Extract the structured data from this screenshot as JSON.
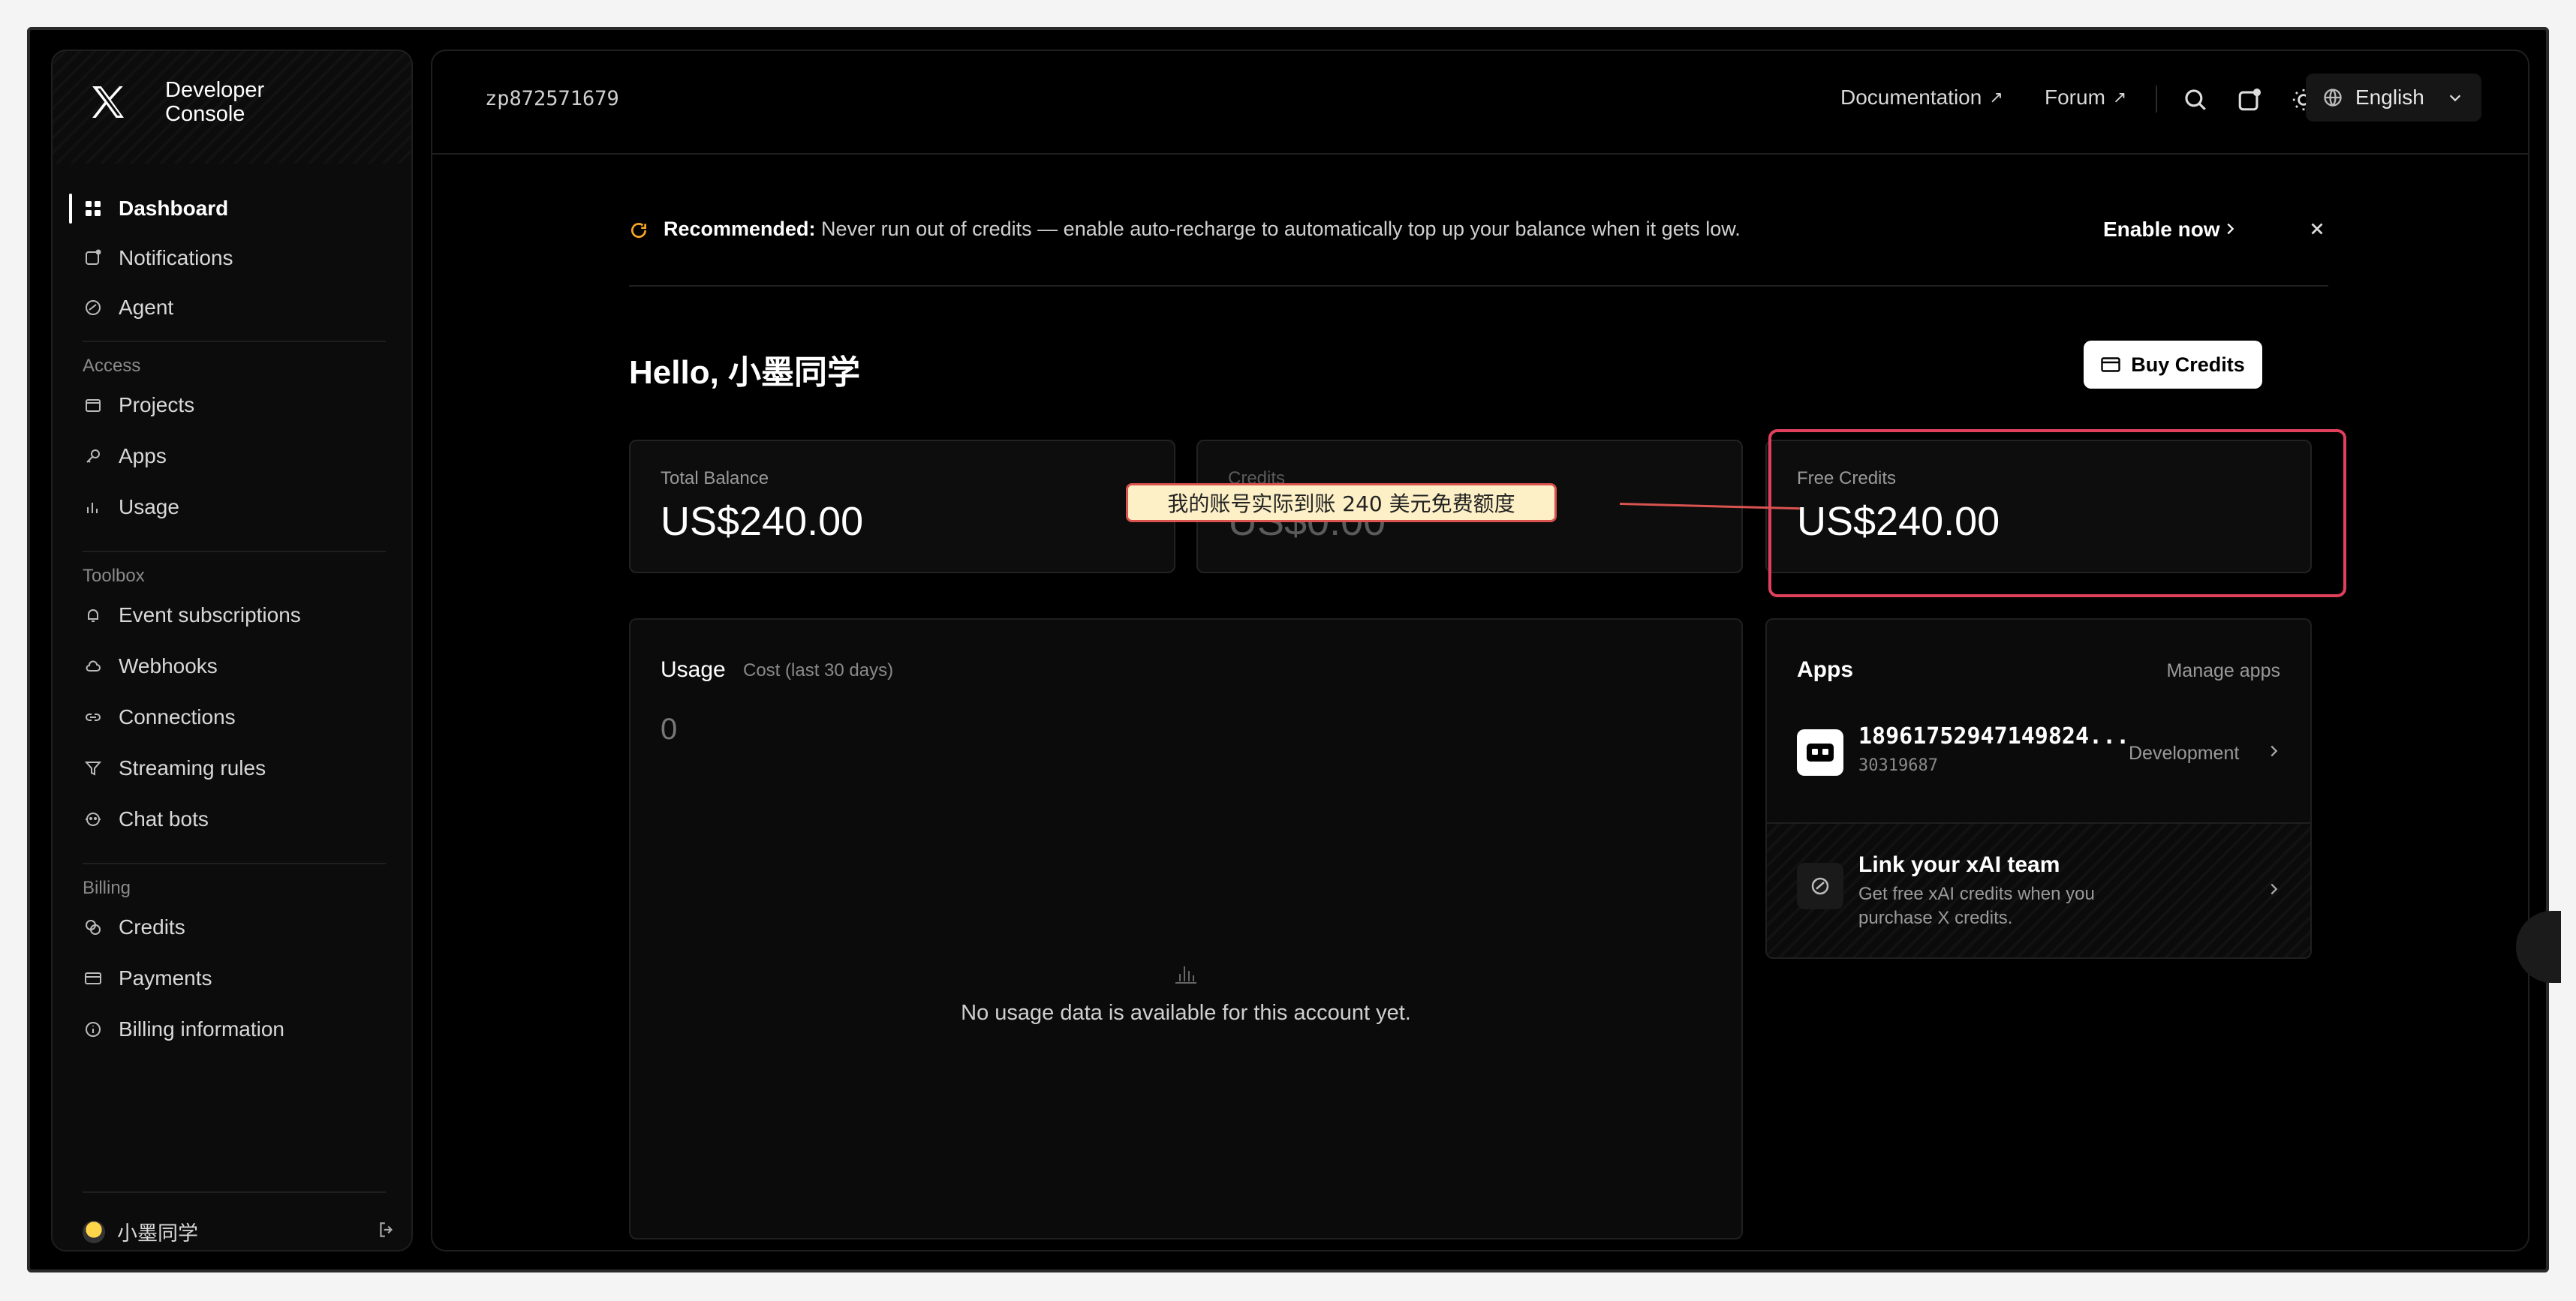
{
  "brand": {
    "title": "Developer\nConsole"
  },
  "sidebar": {
    "main_items": [
      {
        "label": "Dashboard",
        "icon": "grid-icon"
      },
      {
        "label": "Notifications",
        "icon": "notification-icon"
      },
      {
        "label": "Agent",
        "icon": "agent-icon"
      }
    ],
    "access_label": "Access",
    "access_items": [
      {
        "label": "Projects",
        "icon": "folder-icon"
      },
      {
        "label": "Apps",
        "icon": "key-icon"
      },
      {
        "label": "Usage",
        "icon": "bar-chart-icon"
      }
    ],
    "toolbox_label": "Toolbox",
    "toolbox_items": [
      {
        "label": "Event subscriptions",
        "icon": "bell-icon"
      },
      {
        "label": "Webhooks",
        "icon": "cloud-icon"
      },
      {
        "label": "Connections",
        "icon": "link-icon"
      },
      {
        "label": "Streaming rules",
        "icon": "filter-icon"
      },
      {
        "label": "Chat bots",
        "icon": "bot-icon"
      }
    ],
    "billing_label": "Billing",
    "billing_items": [
      {
        "label": "Credits",
        "icon": "coins-icon"
      },
      {
        "label": "Payments",
        "icon": "card-icon"
      },
      {
        "label": "Billing information",
        "icon": "info-icon"
      }
    ],
    "user_name": "小墨同学"
  },
  "topbar": {
    "account_id": "zp872571679",
    "documentation": "Documentation",
    "forum": "Forum",
    "language": "English"
  },
  "banner": {
    "label": "Recommended:",
    "text": " Never run out of credits — enable auto-recharge to automatically top up your balance when it gets low.",
    "action": "Enable now"
  },
  "greeting": "Hello, 小墨同学",
  "buy_credits": "Buy Credits",
  "cards": [
    {
      "label": "Total Balance",
      "value": "US$240.00"
    },
    {
      "label": "Credits",
      "value": "US$0.00"
    },
    {
      "label": "Free Credits",
      "value": "US$240.00"
    }
  ],
  "annotation": "我的账号实际到账 240 美元免费额度",
  "usage": {
    "title": "Usage",
    "subtitle": "Cost (last 30 days)",
    "value": "0",
    "empty_message": "No usage data is available for this account yet."
  },
  "apps": {
    "title": "Apps",
    "manage": "Manage apps",
    "app_name": "18961752947149824...",
    "app_id": "30319687",
    "app_env": "Development",
    "link_title": "Link your xAI team",
    "link_desc": "Get free xAI credits when you purchase X credits."
  },
  "colors": {
    "background": "#000000",
    "highlight": "#e0405b",
    "callout_bg": "#fdf0c6",
    "banner_icon": "#f5a623"
  }
}
